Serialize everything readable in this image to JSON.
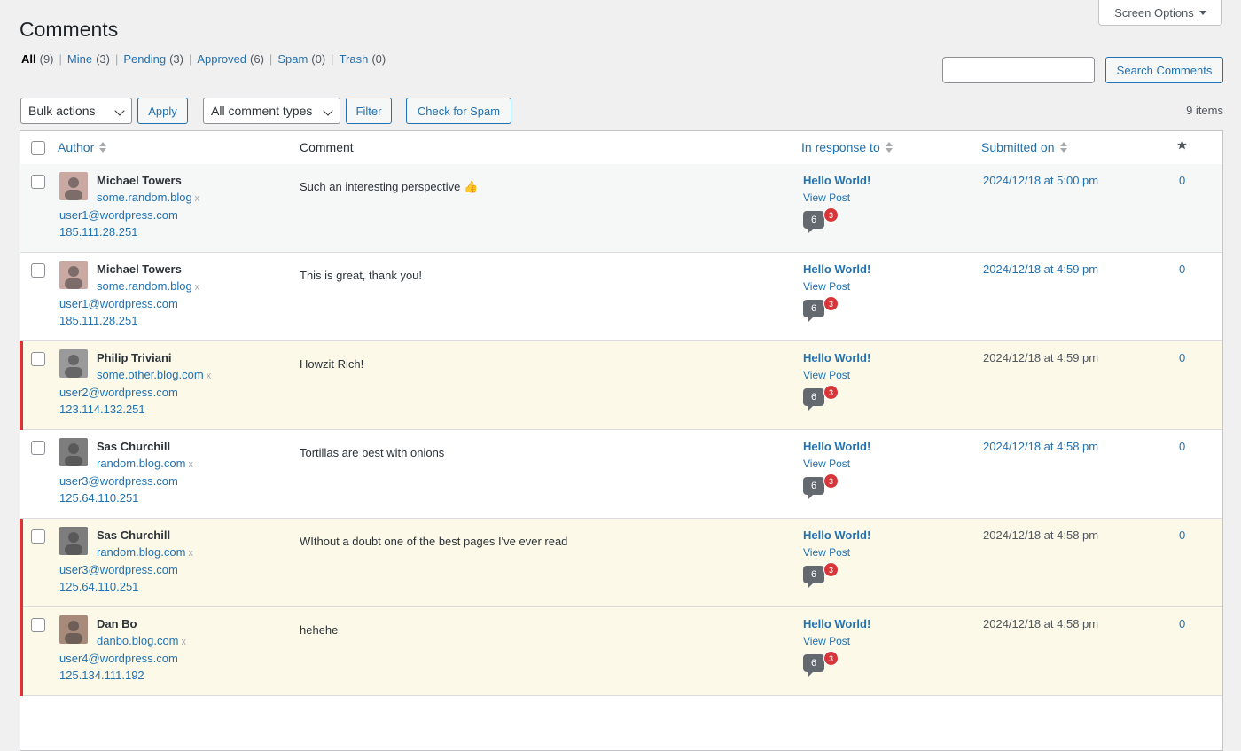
{
  "page": {
    "title": "Comments",
    "screen_options": "Screen Options"
  },
  "filters": [
    {
      "label": "All",
      "count": "(9)",
      "current": true
    },
    {
      "label": "Mine",
      "count": "(3)",
      "current": false
    },
    {
      "label": "Pending",
      "count": "(3)",
      "current": false
    },
    {
      "label": "Approved",
      "count": "(6)",
      "current": false
    },
    {
      "label": "Spam",
      "count": "(0)",
      "current": false
    },
    {
      "label": "Trash",
      "count": "(0)",
      "current": false
    }
  ],
  "search": {
    "placeholder": "",
    "button": "Search Comments"
  },
  "toolbar": {
    "bulk_actions": "Bulk actions",
    "apply": "Apply",
    "comment_types": "All comment types",
    "filter": "Filter",
    "check_spam": "Check for Spam",
    "items_count": "9 items"
  },
  "table": {
    "columns": {
      "author": "Author",
      "comment": "Comment",
      "in_response_to": "In response to",
      "submitted_on": "Submitted on"
    },
    "rows": [
      {
        "name": "Michael Towers",
        "url": "some.random.blog",
        "email": "user1@wordpress.com",
        "ip": "185.111.28.251",
        "comment": "Such an interesting perspective 👍",
        "post": "Hello World!",
        "view": "View Post",
        "comments": "6",
        "pending": "3",
        "submitted": "2024/12/18 at 5:00 pm",
        "rating": "0",
        "status": "approved",
        "avatar": "#c9a9a2"
      },
      {
        "name": "Michael Towers",
        "url": "some.random.blog",
        "email": "user1@wordpress.com",
        "ip": "185.111.28.251",
        "comment": "This is great, thank you!",
        "post": "Hello World!",
        "view": "View Post",
        "comments": "6",
        "pending": "3",
        "submitted": "2024/12/18 at 4:59 pm",
        "rating": "0",
        "status": "approved",
        "avatar": "#c9a9a2"
      },
      {
        "name": "Philip Triviani",
        "url": "some.other.blog.com",
        "email": "user2@wordpress.com",
        "ip": "123.114.132.251",
        "comment": "Howzit Rich!",
        "post": "Hello World!",
        "view": "View Post",
        "comments": "6",
        "pending": "3",
        "submitted": "2024/12/18 at 4:59 pm",
        "rating": "0",
        "status": "unapproved",
        "avatar": "#9a9a9a"
      },
      {
        "name": "Sas Churchill",
        "url": "random.blog.com",
        "email": "user3@wordpress.com",
        "ip": "125.64.110.251",
        "comment": "Tortillas are best with onions",
        "post": "Hello World!",
        "view": "View Post",
        "comments": "6",
        "pending": "3",
        "submitted": "2024/12/18 at 4:58 pm",
        "rating": "0",
        "status": "approved",
        "avatar": "#7d7d7d"
      },
      {
        "name": "Sas Churchill",
        "url": "random.blog.com",
        "email": "user3@wordpress.com",
        "ip": "125.64.110.251",
        "comment": "WIthout a doubt one of the best pages I've ever read",
        "post": "Hello World!",
        "view": "View Post",
        "comments": "6",
        "pending": "3",
        "submitted": "2024/12/18 at 4:58 pm",
        "rating": "0",
        "status": "unapproved",
        "avatar": "#7d7d7d"
      },
      {
        "name": "Dan Bo",
        "url": "danbo.blog.com",
        "email": "user4@wordpress.com",
        "ip": "125.134.111.192",
        "comment": "hehehe",
        "post": "Hello World!",
        "view": "View Post",
        "comments": "6",
        "pending": "3",
        "submitted": "2024/12/18 at 4:58 pm",
        "rating": "0",
        "status": "unapproved",
        "avatar": "#a88a7a"
      }
    ]
  }
}
